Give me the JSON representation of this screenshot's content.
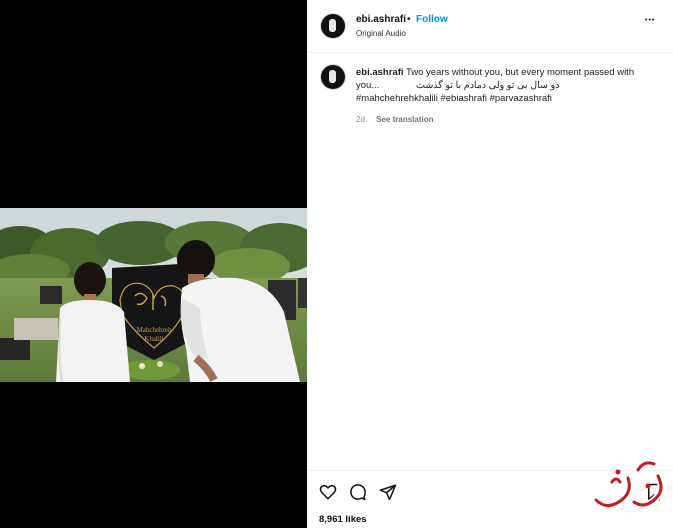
{
  "post": {
    "username": "ebi.ashrafi",
    "separator": "•",
    "follow_label": "Follow",
    "audio_label": "Original Audio",
    "more_label": "•••"
  },
  "caption": {
    "username": "ebi.ashrafi",
    "text_en": "Two years without you, but every moment passed with you...",
    "text_fa": "دو سال بی تو ولی دمادم با تو گذشت",
    "hashtags": "#mahchehrehkhalili #ebiashrafi #parvazashrafi",
    "age": "2d",
    "see_translation": "See translation"
  },
  "photo": {
    "headstone_name_line1": "Mahchehreh",
    "headstone_name_line2": "Khalili"
  },
  "footer": {
    "likes": "8,961 likes"
  },
  "icons": [
    "heart-icon",
    "comment-icon",
    "share-icon",
    "more-icon"
  ],
  "colors": {
    "follow": "#0095f6",
    "muted": "#8e8e8e"
  }
}
